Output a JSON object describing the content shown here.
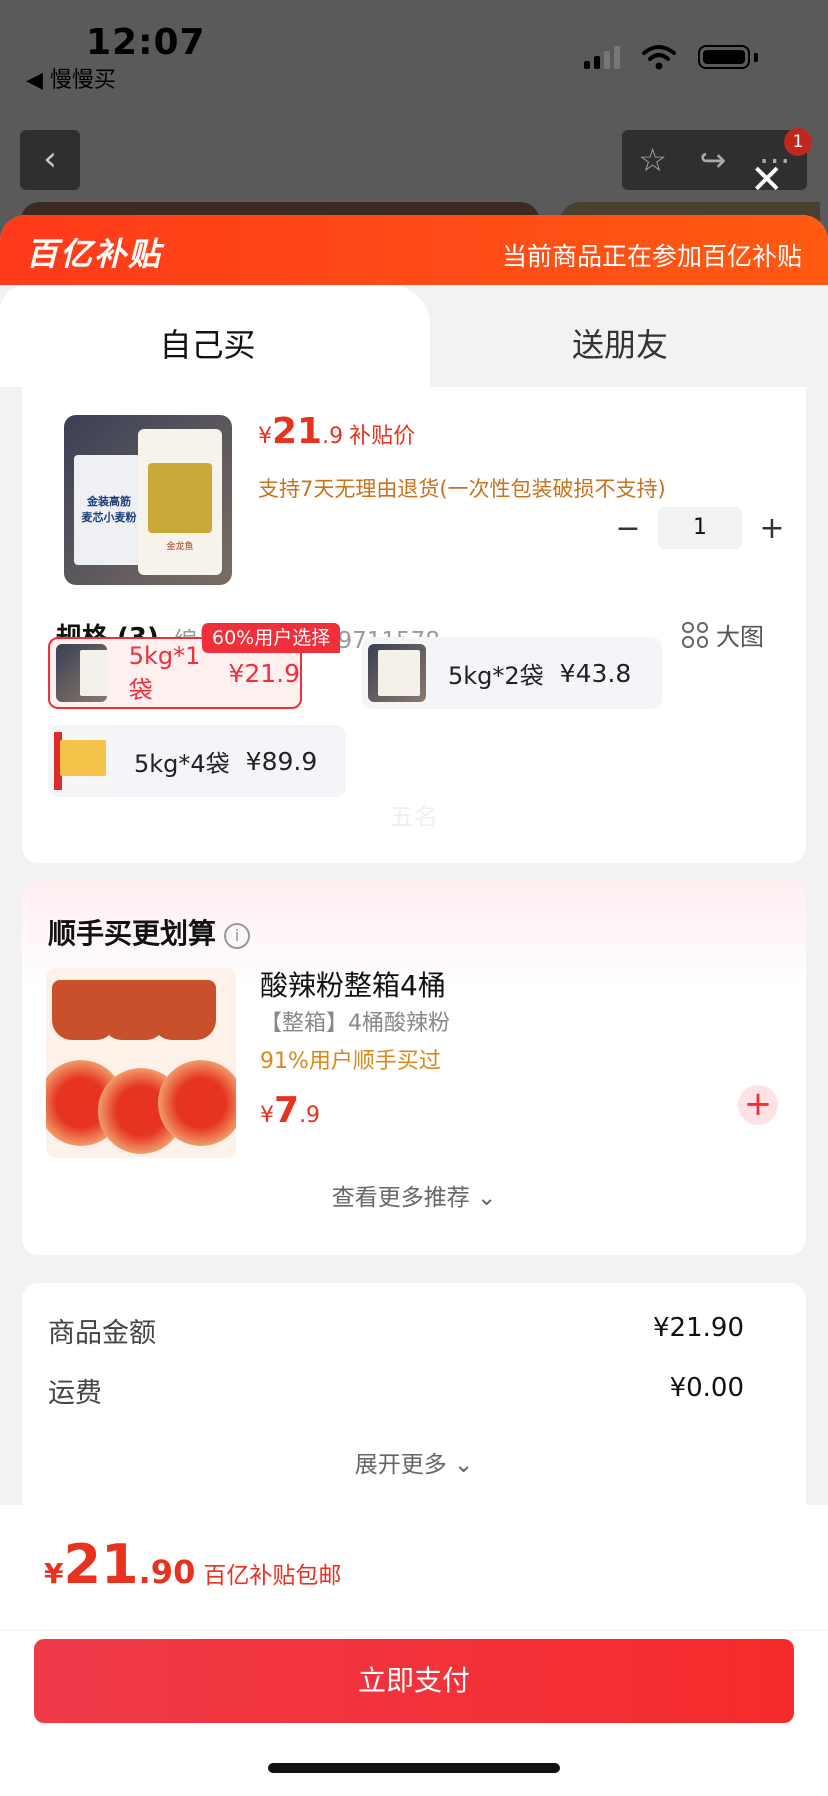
{
  "status": {
    "time": "12:07",
    "back_app": "◀ 慢慢买"
  },
  "colors": {
    "accent": "#e8321f",
    "banner": "#ff4a16",
    "pay_button": "#f03a4a"
  },
  "banner": {
    "logo": "百亿补贴",
    "note": "当前商品正在参加百亿补贴"
  },
  "tabs": [
    {
      "label": "自己买"
    },
    {
      "label": "送朋友"
    }
  ],
  "product": {
    "price_symbol": "¥",
    "price_int": "21",
    "price_dec": ".9",
    "price_tag": "补贴价",
    "return_note": "支持7天无理由退货(一次性包装破损不支持)",
    "quantity": "1",
    "minus": "−",
    "plus": "+"
  },
  "spec": {
    "title": "规格 (3)",
    "code": "编号: 10116489711578",
    "big_image": "大图",
    "options": [
      {
        "name": "5kg*1袋",
        "price": "¥21.9",
        "selected": true,
        "badge": "60%用户选择"
      },
      {
        "name": "5kg*2袋",
        "price": "¥43.8",
        "selected": false
      },
      {
        "name": "5kg*4袋",
        "price": "¥89.9",
        "selected": false
      }
    ]
  },
  "watermark": "五名",
  "addon": {
    "title": "顺手买更划算",
    "info_icon": "i",
    "item": {
      "title": "酸辣粉整箱4桶",
      "subtitle": "【整箱】4桶酸辣粉",
      "stat": "91%用户顺手买过",
      "price_symbol": "¥",
      "price_int": "7",
      "price_dec": ".9",
      "add": "+"
    },
    "more": "查看更多推荐 ⌄"
  },
  "summary": {
    "rows": [
      {
        "label": "商品金额",
        "value": "¥21.90"
      },
      {
        "label": "运费",
        "value": "¥0.00"
      }
    ],
    "expand": "展开更多 ⌄"
  },
  "footer": {
    "total_symbol": "¥",
    "total_int": "21",
    "total_dec": ".90",
    "total_note": "百亿补贴包邮",
    "pay_button": "立即支付"
  },
  "background": {
    "badge_count": "1",
    "back_icon": "‹",
    "close_icon": "✕"
  }
}
